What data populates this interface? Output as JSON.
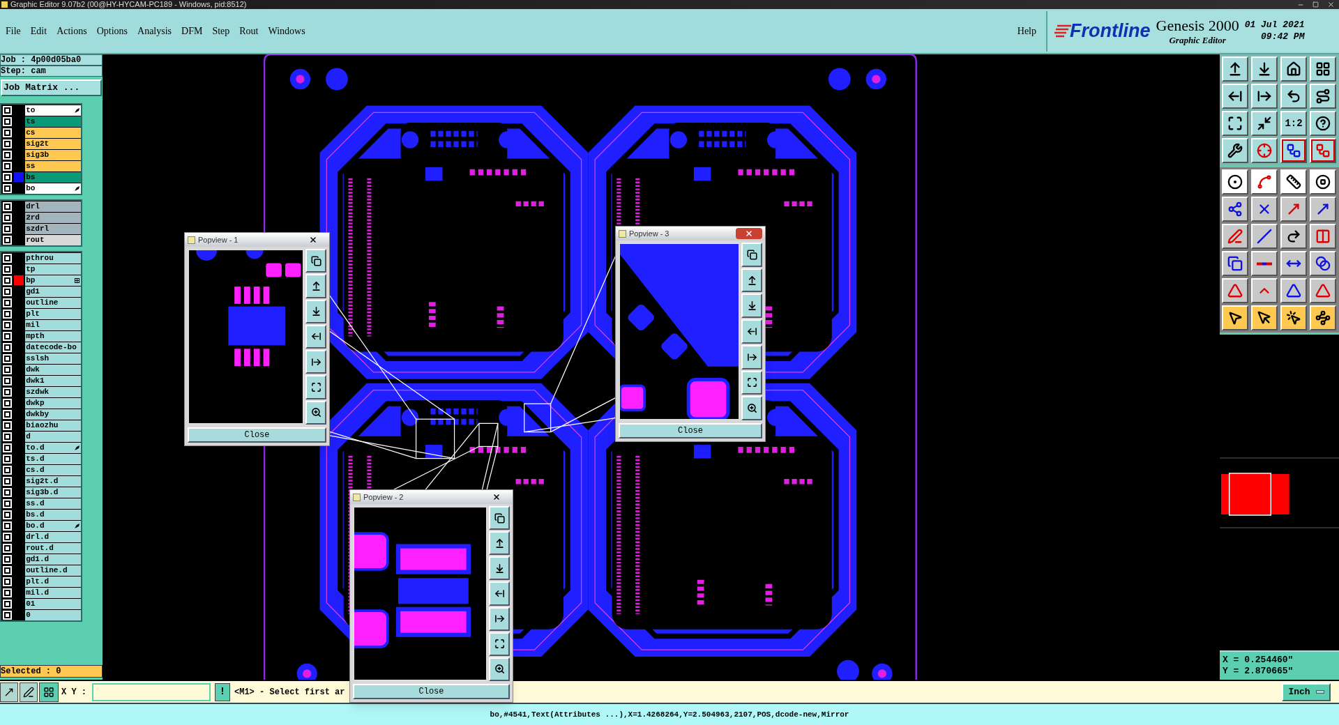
{
  "title_bar": {
    "title": "Graphic Editor 9.07b2 (00@HY-HYCAM-PC189 - Windows, pid:8512)"
  },
  "menu": [
    "File",
    "Edit",
    "Actions",
    "Options",
    "Analysis",
    "DFM",
    "Step",
    "Rout",
    "Windows"
  ],
  "help": "Help",
  "brand": {
    "logo": "Frontline",
    "product": "Genesis 2000",
    "subtitle": "Graphic Editor",
    "date": "01 Jul 2021",
    "time": "09:42 PM"
  },
  "job": {
    "job": "Job : 4p00d05ba0",
    "step": "Step: cam",
    "matrix_button": "Job Matrix ..."
  },
  "layer_groups": [
    {
      "layers": [
        {
          "name": "to",
          "color": "#ffffff",
          "kind": "arrow",
          "selected": false
        },
        {
          "name": "ts",
          "color": "#0a9a78",
          "kind": "plain",
          "selected": false
        },
        {
          "name": "cs",
          "color": "#ffc850",
          "kind": "plain",
          "selected": false
        },
        {
          "name": "sig2t",
          "color": "#ffc850",
          "kind": "plain",
          "selected": false
        },
        {
          "name": "sig3b",
          "color": "#ffc850",
          "kind": "plain",
          "selected": false
        },
        {
          "name": "ss",
          "color": "#ffc850",
          "kind": "plain",
          "selected": false
        },
        {
          "name": "bs",
          "color": "#0a9a78",
          "swatch": {
            "color": "#1010ff"
          },
          "kind": "plain",
          "selected": false
        },
        {
          "name": "bo",
          "color": "#ffffff",
          "kind": "arrow",
          "selected": false
        }
      ]
    },
    {
      "layers": [
        {
          "name": "drl",
          "color": "#a3b4bc",
          "kind": "plain",
          "selected": false
        },
        {
          "name": "2rd",
          "color": "#a3b4bc",
          "kind": "plain",
          "selected": false
        },
        {
          "name": "szdrl",
          "color": "#a3b4bc",
          "kind": "plain",
          "selected": false
        },
        {
          "name": "rout",
          "color": "#d8d8d8",
          "kind": "plain",
          "selected": false
        }
      ]
    },
    {
      "layers": [
        {
          "name": "pthrou",
          "color": "#a3dcdc",
          "kind": "plain",
          "selected": false
        },
        {
          "name": "tp",
          "color": "#a3dcdc",
          "kind": "plain",
          "selected": false
        },
        {
          "name": "bp",
          "color": "#a3dcdc",
          "swatch": {
            "color": "#ff0000"
          },
          "kind": "grid",
          "selected": true
        },
        {
          "name": "gd1",
          "color": "#a3dcdc",
          "kind": "plain",
          "selected": false
        },
        {
          "name": "outline",
          "color": "#a3dcdc",
          "kind": "plain",
          "selected": false
        },
        {
          "name": "plt",
          "color": "#a3dcdc",
          "kind": "plain",
          "selected": false
        },
        {
          "name": "mil",
          "color": "#a3dcdc",
          "kind": "plain",
          "selected": false
        },
        {
          "name": "mpth",
          "color": "#a3dcdc",
          "kind": "plain",
          "selected": false
        },
        {
          "name": "datecode-bo",
          "color": "#a3dcdc",
          "kind": "plain",
          "selected": false
        },
        {
          "name": "sslsh",
          "color": "#a3dcdc",
          "kind": "plain",
          "selected": false
        },
        {
          "name": "dwk",
          "color": "#a3dcdc",
          "kind": "plain",
          "selected": false
        },
        {
          "name": "dwk1",
          "color": "#a3dcdc",
          "kind": "plain",
          "selected": false
        },
        {
          "name": "szdwk",
          "color": "#a3dcdc",
          "kind": "plain",
          "selected": false
        },
        {
          "name": "dwkp",
          "color": "#a3dcdc",
          "kind": "plain",
          "selected": false
        },
        {
          "name": "dwkby",
          "color": "#a3dcdc",
          "kind": "plain",
          "selected": false
        },
        {
          "name": "biaozhu",
          "color": "#a3dcdc",
          "kind": "plain",
          "selected": false
        },
        {
          "name": "d",
          "color": "#a3dcdc",
          "kind": "plain",
          "selected": false
        },
        {
          "name": "to.d",
          "color": "#a3dcdc",
          "kind": "arrow",
          "selected": false
        },
        {
          "name": "ts.d",
          "color": "#a3dcdc",
          "kind": "plain",
          "selected": false
        },
        {
          "name": "cs.d",
          "color": "#a3dcdc",
          "kind": "plain",
          "selected": false
        },
        {
          "name": "sig2t.d",
          "color": "#a3dcdc",
          "kind": "plain",
          "selected": false
        },
        {
          "name": "sig3b.d",
          "color": "#a3dcdc",
          "kind": "plain",
          "selected": false
        },
        {
          "name": "ss.d",
          "color": "#a3dcdc",
          "kind": "plain",
          "selected": false
        },
        {
          "name": "bs.d",
          "color": "#a3dcdc",
          "kind": "plain",
          "selected": false
        },
        {
          "name": "bo.d",
          "color": "#a3dcdc",
          "kind": "arrow",
          "selected": false
        },
        {
          "name": "drl.d",
          "color": "#a3dcdc",
          "kind": "plain",
          "selected": false
        },
        {
          "name": "rout.d",
          "color": "#a3dcdc",
          "kind": "plain",
          "selected": false
        },
        {
          "name": "gd1.d",
          "color": "#a3dcdc",
          "kind": "plain",
          "selected": false
        },
        {
          "name": "outline.d",
          "color": "#a3dcdc",
          "kind": "plain",
          "selected": false
        },
        {
          "name": "plt.d",
          "color": "#a3dcdc",
          "kind": "plain",
          "selected": false
        },
        {
          "name": "mil.d",
          "color": "#a3dcdc",
          "kind": "plain",
          "selected": false
        },
        {
          "name": "01",
          "color": "#a3dcdc",
          "kind": "plain",
          "selected": false
        },
        {
          "name": "0",
          "color": "#a3dcdc",
          "kind": "plain",
          "selected": false
        }
      ]
    }
  ],
  "selected_count": "Selected : 0",
  "popviews": [
    {
      "title": "Popview - 1",
      "focused": false,
      "close": "Close"
    },
    {
      "title": "Popview - 3",
      "focused": true,
      "close": "Close"
    },
    {
      "title": "Popview - 2",
      "focused": false,
      "close": "Close"
    }
  ],
  "toolbar_ratio": "1:2",
  "readout": {
    "x": "X = 0.254460\"",
    "y": "Y = 2.870665\""
  },
  "command_bar": {
    "xy_label": "X Y :",
    "alert_button": "!",
    "message": "<M1> - Select first ar",
    "unit": "Inch"
  },
  "status": "bo,#4541,Text(Attributes ...),X=1.4268264,Y=2.504963,2107,POS,dcode-new,Mirror"
}
